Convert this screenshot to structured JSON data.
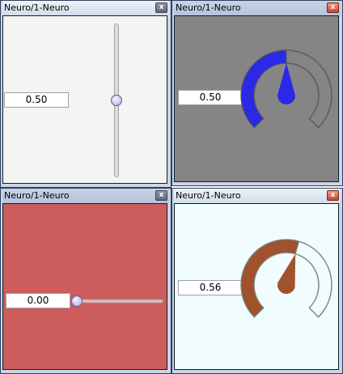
{
  "windows": [
    {
      "title": "Neuro/1-Neuro",
      "close_label": "x",
      "value_text": "0.50",
      "widget": "vertical-slider",
      "value": 0.5,
      "background": "#f4f4f4"
    },
    {
      "title": "Neuro/1-Neuro",
      "close_label": "x",
      "value_text": "0.50",
      "widget": "gauge",
      "value": 0.5,
      "background": "#858585",
      "gauge_fill": "#2929e6",
      "gauge_outline": "#5c5c5c"
    },
    {
      "title": "Neuro/1-Neuro",
      "close_label": "x",
      "value_text": "0.00",
      "widget": "horizontal-slider",
      "value": 0.0,
      "background": "#cd5c5c"
    },
    {
      "title": "Neuro/1-Neuro",
      "close_label": "x",
      "value_text": "0.56",
      "widget": "gauge",
      "value": 0.56,
      "background": "#f0fcfd",
      "gauge_fill": "#a0522d",
      "gauge_outline": "#7c8a86"
    }
  ],
  "icons": {
    "close": "close-icon"
  }
}
